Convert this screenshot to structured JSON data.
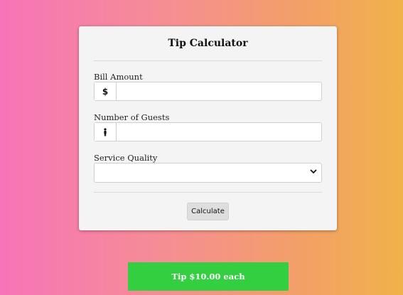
{
  "calculator": {
    "title": "Tip Calculator",
    "bill": {
      "label": "Bill Amount",
      "addon": "$",
      "value": ""
    },
    "guests": {
      "label": "Number of Guests",
      "addon_icon": "person-icon",
      "value": ""
    },
    "service": {
      "label": "Service Quality",
      "selected": ""
    },
    "calculate_label": "Calculate"
  },
  "result": {
    "text": "Tip $10.00 each",
    "color": "#34cf40"
  }
}
